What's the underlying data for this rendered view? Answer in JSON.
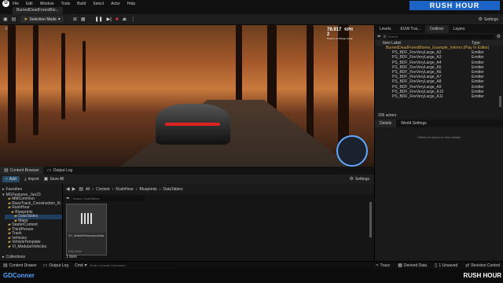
{
  "menu": {
    "items": [
      "File",
      "Edit",
      "Window",
      "Tools",
      "Build",
      "Select",
      "Actor",
      "Help"
    ]
  },
  "level_tab": "BurnedDeadForestBio...",
  "brand": "RUSH HOUR",
  "toolbar": {
    "mode": "Selection Mode",
    "settings": "Settings"
  },
  "viewport": {
    "speed": "78.917",
    "unit": "KPH",
    "gear": "2",
    "note": "Press L to change views"
  },
  "outliner": {
    "tabs": [
      "Levels",
      "EUW Trai...",
      "Outliner",
      "Layers"
    ],
    "search_placeholder": "Search",
    "col_label": "Item Label",
    "col_type": "Type",
    "header_row": "BurnedDeadForestBiome_Example_Inferno (Play In Editor)",
    "rows": [
      {
        "name": "PS_BDF_FireVeryLarge_A2",
        "type": "Emitter"
      },
      {
        "name": "PS_BDF_FireVeryLarge_A3",
        "type": "Emitter"
      },
      {
        "name": "PS_BDF_FireVeryLarge_A4",
        "type": "Emitter"
      },
      {
        "name": "PS_BDF_FireVeryLarge_A5",
        "type": "Emitter"
      },
      {
        "name": "PS_BDF_FireVeryLarge_A6",
        "type": "Emitter"
      },
      {
        "name": "PS_BDF_FireVeryLarge_A7",
        "type": "Emitter"
      },
      {
        "name": "PS_BDF_FireVeryLarge_A8",
        "type": "Emitter"
      },
      {
        "name": "PS_BDF_FireVeryLarge_A9",
        "type": "Emitter"
      },
      {
        "name": "PS_BDF_FireVeryLarge_A10",
        "type": "Emitter"
      },
      {
        "name": "PS_BDF_FireVeryLarge_A11",
        "type": "Emitter"
      }
    ],
    "actor_count": "206 actors"
  },
  "details": {
    "tab1": "Details",
    "tab2": "World Settings",
    "empty": "Select an object to view details"
  },
  "content_browser": {
    "tab": "Content Browser",
    "tab2": "Output Log",
    "add": "Add",
    "import": "Import",
    "save_all": "Save All",
    "path": [
      "All",
      "Content",
      "RushHour",
      "Blueprints",
      "DataTables"
    ],
    "settings": "Settings",
    "search_placeholder": "Search DataTables",
    "favorites": "Favorites",
    "project": "MGFeatures_Jun23",
    "tree": [
      "MMCommon",
      "RaceTrack_Construction_Ki",
      "RushHour",
      "Blueprints",
      "DataTables",
      "Maps",
      "StarterContent",
      "ThirdPerson",
      "Track",
      "Vehicles",
      "VehicleTemplate",
      "Vl_ModularVehicles"
    ],
    "collections": "Collections",
    "asset_name": "DT_VehiclePerformanceData",
    "asset_type": "Data Table",
    "count": "1 item"
  },
  "status": {
    "drawer": "Content Drawer",
    "output": "Output Log",
    "cmd": "Cmd",
    "cmd_placeholder": "Enter Console Command",
    "trace": "Trace",
    "derived": "Derived Data",
    "unsaved": "1 Unsaved",
    "revision": "Revision Control"
  },
  "watermark": "GDConner"
}
